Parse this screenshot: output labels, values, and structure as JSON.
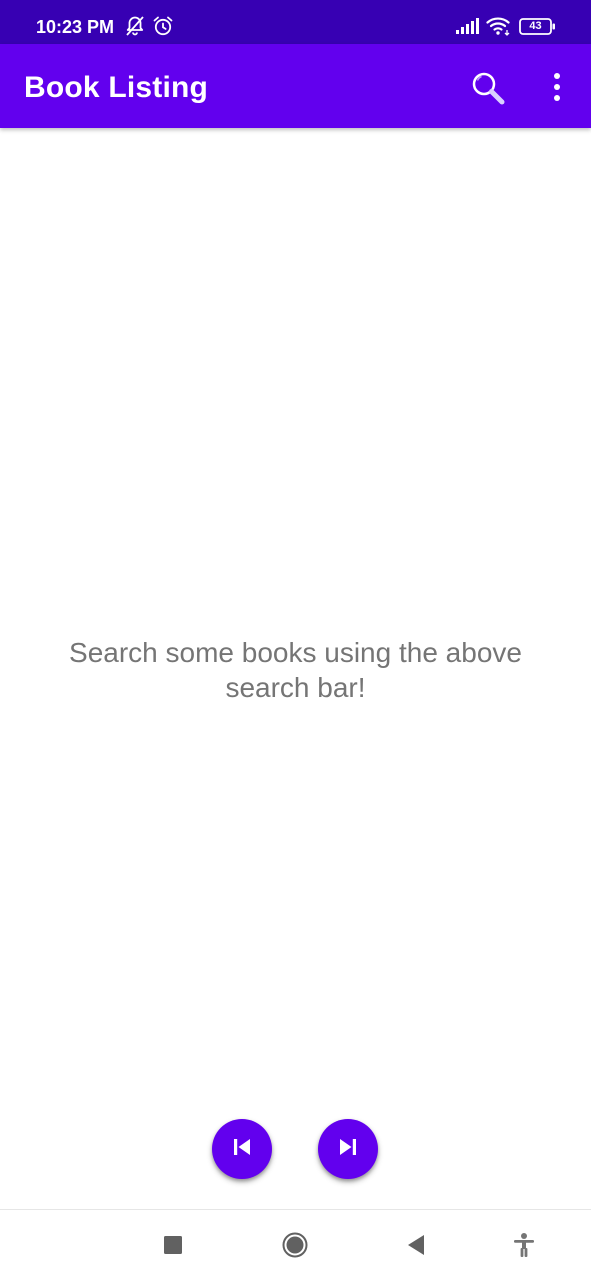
{
  "status_bar": {
    "time": "10:23 PM",
    "battery_level": "43",
    "icons": [
      "notifications-off-icon",
      "alarm-icon",
      "signal-icon",
      "wifi-icon",
      "battery-icon"
    ],
    "background_color": "#3700b3"
  },
  "app_bar": {
    "title": "Book Listing",
    "actions": [
      "search-icon",
      "more-options-icon"
    ],
    "background_color": "#6200ee"
  },
  "main": {
    "empty_message": "Search some books using the above search bar!"
  },
  "pagination": {
    "buttons": [
      "previous-page-icon",
      "next-page-icon"
    ],
    "color": "#6200ee"
  },
  "nav_bar": {
    "buttons": [
      "recents-icon",
      "home-icon",
      "back-icon",
      "accessibility-icon"
    ]
  }
}
